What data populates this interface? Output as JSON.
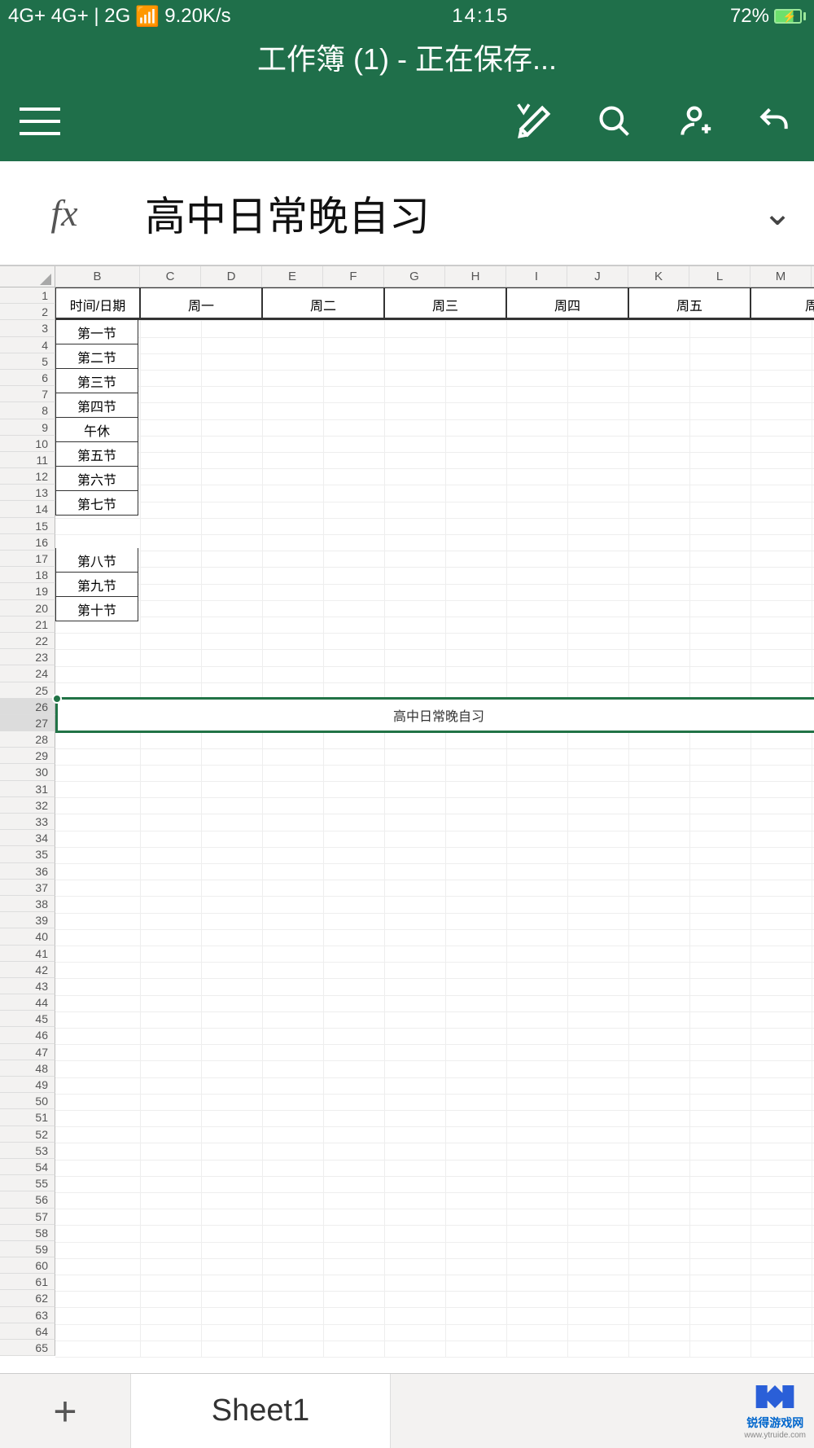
{
  "status": {
    "network": "4G+ 4G+ | 2G",
    "speed": "9.20K/s",
    "time": "14:15",
    "battery_pct": "72%"
  },
  "title": "工作簿 (1) - 正在保存...",
  "formula": {
    "fx": "fx",
    "value": "高中日常晚自习",
    "expand": "⌄"
  },
  "columns": [
    "B",
    "C",
    "D",
    "E",
    "F",
    "G",
    "H",
    "I",
    "J",
    "K",
    "L",
    "M"
  ],
  "rows_visible": 65,
  "table": {
    "corner": "时间/日期",
    "day_headers": [
      "周一",
      "周二",
      "周三",
      "周四",
      "周五",
      "周"
    ],
    "row_labels": [
      "第一节",
      "第二节",
      "第三节",
      "第四节",
      "午休",
      "第五节",
      "第六节",
      "第七节",
      "",
      "第八节",
      "第九节",
      "第十节"
    ]
  },
  "selected_cell": {
    "value": "高中日常晚自习",
    "row_start": 26,
    "row_end": 27
  },
  "sheet": {
    "active": "Sheet1",
    "add": "+"
  },
  "watermark": {
    "name": "锐得游戏网",
    "url": "www.ytruide.com"
  },
  "colors": {
    "primary": "#1f6f4a",
    "selection": "#217346"
  }
}
